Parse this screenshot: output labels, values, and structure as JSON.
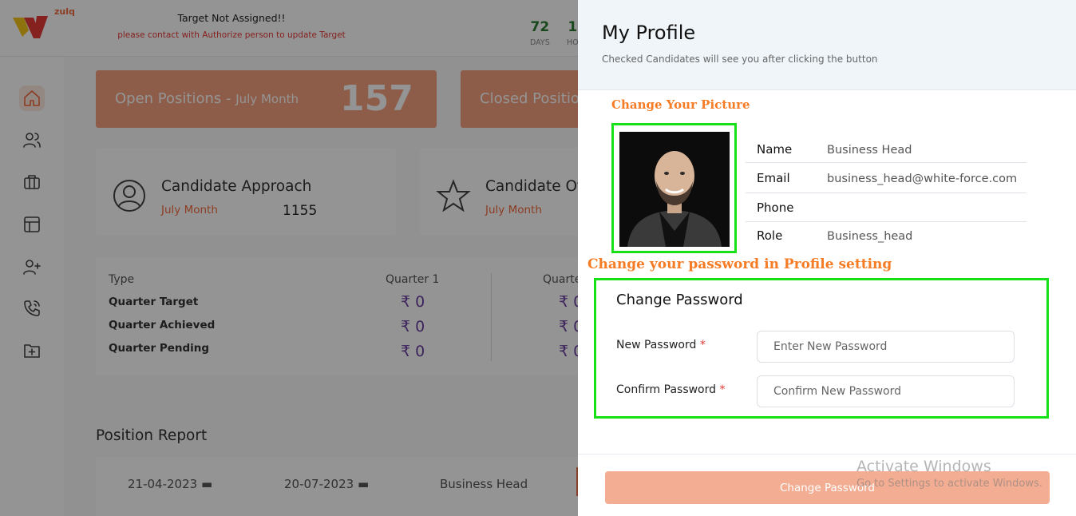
{
  "header": {
    "target_title": "Target Not Assigned!!",
    "target_sub": "please contact with Authorize person to update Target",
    "timer": [
      {
        "value": "72",
        "label": "DAYS"
      },
      {
        "value": "1",
        "label": "HO"
      }
    ],
    "brand_color": "#f26a3d"
  },
  "sidebar": {
    "items": [
      "home-icon",
      "users-icon",
      "briefcase-icon",
      "layout-icon",
      "user-plus-icon",
      "phone-icon",
      "folder-plus-icon"
    ]
  },
  "stats": [
    {
      "label": "Open Positions - ",
      "month": "July Month",
      "value": "157"
    },
    {
      "label": "Closed Positio",
      "month": "",
      "value": ""
    }
  ],
  "info_cards": [
    {
      "title": "Candidate Approach",
      "sub": "July Month",
      "value": "1155"
    },
    {
      "title": "Candidate Of",
      "sub": "July Month",
      "value": ""
    }
  ],
  "quarter": {
    "type_label": "Type",
    "col1": "Quarter 1",
    "col2": "Quarte",
    "rows": [
      "Quarter Target",
      "Quarter Achieved",
      "Quarter Pending"
    ],
    "values_q1": [
      "₹ 0",
      "₹ 0",
      "₹ 0"
    ],
    "values_q2": [
      "₹ 0",
      "₹ 0",
      "₹ 0"
    ]
  },
  "report": {
    "title": "Position Report",
    "from_date": "21-04-2023",
    "to_date": "20-07-2023",
    "role": "Business Head"
  },
  "drawer": {
    "title": "My Profile",
    "subtitle": "Checked Candidates will see you after clicking the button",
    "annotation_picture": "Change Your Picture",
    "annotation_password": "Change your password in Profile setting",
    "profile": {
      "name_label": "Name",
      "name_value": "Business Head",
      "email_label": "Email",
      "email_value": "business_head@white-force.com",
      "phone_label": "Phone",
      "phone_value": "",
      "role_label": "Role",
      "role_value": "Business_head"
    },
    "change_password": {
      "title": "Change Password",
      "new_label": "New Password",
      "new_placeholder": "Enter New Password",
      "confirm_label": "Confirm Password",
      "confirm_placeholder": "Confirm New Password",
      "required_mark": "*"
    },
    "submit_label": "Change Password"
  },
  "watermark": {
    "line1": "Activate Windows",
    "line2": "Go to Settings to activate Windows."
  }
}
